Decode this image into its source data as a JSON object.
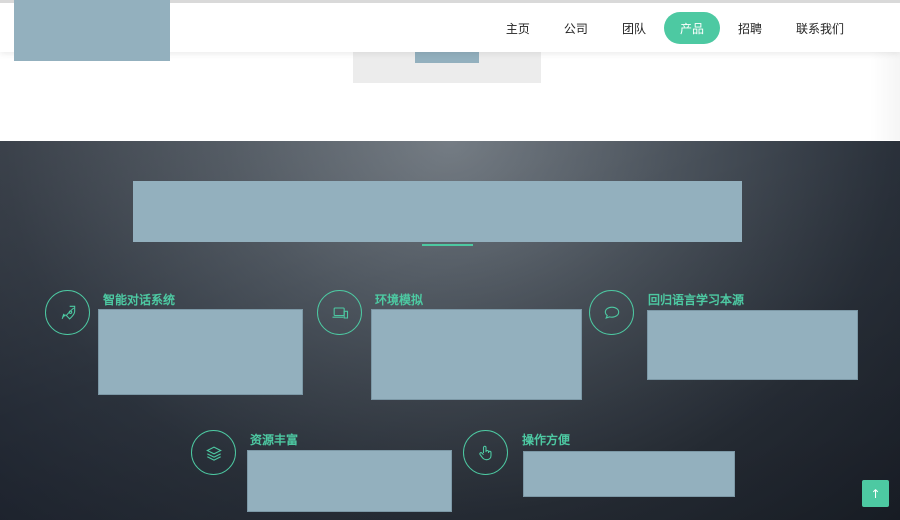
{
  "nav": {
    "items": [
      {
        "label": "主页",
        "active": false
      },
      {
        "label": "公司",
        "active": false
      },
      {
        "label": "团队",
        "active": false
      },
      {
        "label": "产品",
        "active": true
      },
      {
        "label": "招聘",
        "active": false
      },
      {
        "label": "联系我们",
        "active": false
      }
    ]
  },
  "features": [
    {
      "title": "智能对话系统",
      "icon": "rocket-icon"
    },
    {
      "title": "环境模拟",
      "icon": "laptop-icon"
    },
    {
      "title": "回归语言学习本源",
      "icon": "speech-bubble-icon"
    },
    {
      "title": "资源丰富",
      "icon": "layers-icon"
    },
    {
      "title": "操作方便",
      "icon": "hand-pointer-icon"
    }
  ],
  "colors": {
    "accent": "#4dc9a2",
    "placeholder": "#93b0be"
  },
  "back_to_top": {
    "glyph": "↑"
  }
}
